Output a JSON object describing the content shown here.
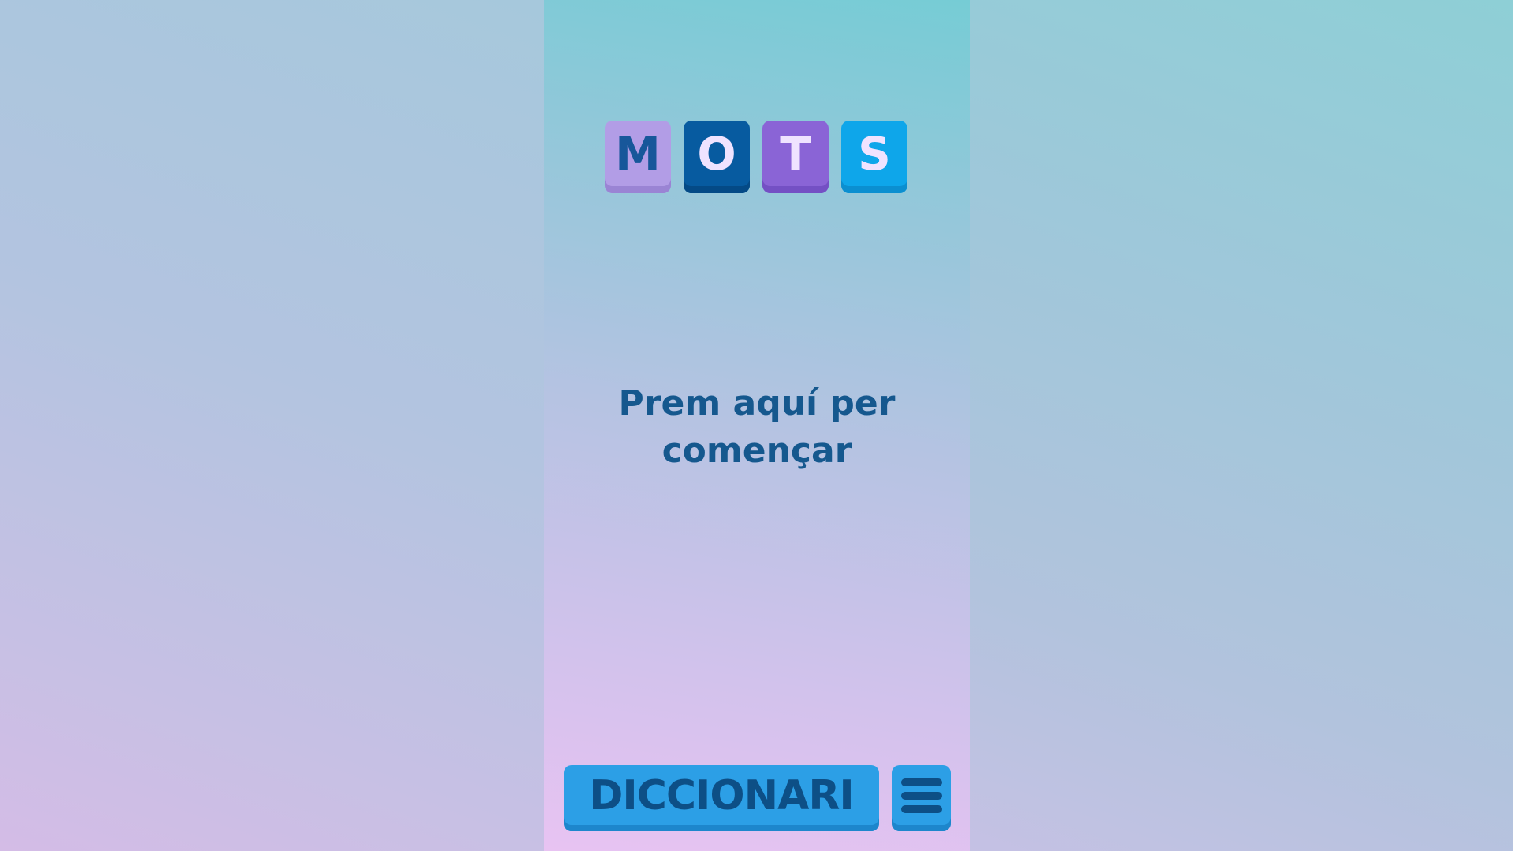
{
  "title_tiles": [
    {
      "letter": "M",
      "color": "#b29de6"
    },
    {
      "letter": "O",
      "color": "#075ba0"
    },
    {
      "letter": "T",
      "color": "#8a64d6"
    },
    {
      "letter": "S",
      "color": "#0ea6ea"
    }
  ],
  "start_prompt": {
    "line1": "Prem aquí per",
    "line2": "començar"
  },
  "bottom_bar": {
    "dictionary_label": "DICCIONARI",
    "menu_icon": "hamburger-menu-icon"
  },
  "colors": {
    "text_primary": "#15588e",
    "button_blue": "#2c9fe6"
  }
}
